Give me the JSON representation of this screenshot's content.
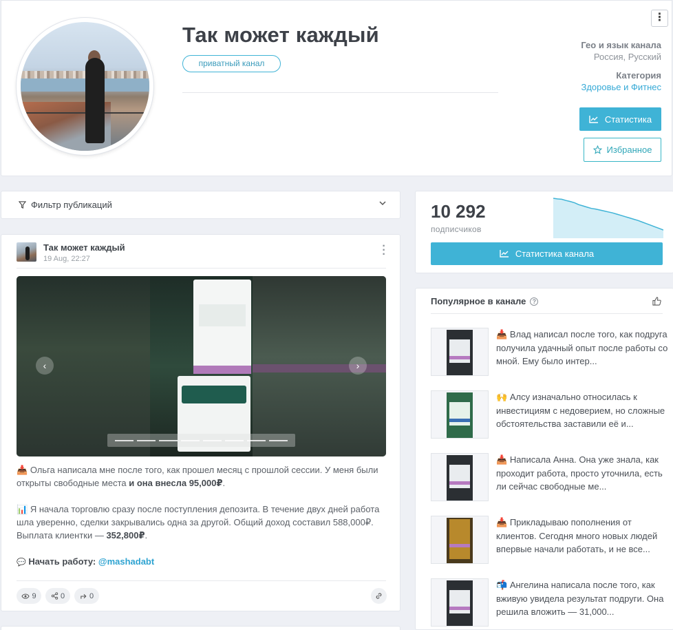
{
  "header": {
    "title": "Так может каждый",
    "badge": "приватный канал",
    "more_icon": "⋮",
    "geo_label": "Гео и язык канала",
    "geo_value": "Россия, Русский",
    "category_label": "Категория",
    "category_value": "Здоровье и Фитнес",
    "stats_button": "Статистика",
    "favorite_button": "Избранное"
  },
  "filter": {
    "label": "Фильтр публикаций"
  },
  "post": {
    "author": "Так может каждый",
    "date": "19 Aug, 22:27",
    "p1_text": "Ольга написала мне после того, как прошел месяц с прошлой сессии. У меня были открыты свободные места ",
    "p1_bold": "и она внесла 95,000₽",
    "p1_end": ".",
    "p2_text": "Я начала торговлю сразу после поступления депозита. В течение двух дней работа шла уверенно, сделки закрывались одна за другой. Общий доход составил 588,000₽. Выплата клиентки — ",
    "p2_bold": "352,800₽",
    "p2_end": ".",
    "p3_bold": "Начать работу: ",
    "p3_link": "@mashadabt",
    "views": "9",
    "shares": "0",
    "forwards": "0",
    "media_nav_prev": "‹",
    "media_nav_next": "›"
  },
  "stats": {
    "subscribers": "10 292",
    "subscribers_label": "подписчиков",
    "button": "Статистика канала",
    "sparkline": [
      1.0,
      0.98,
      0.97,
      0.93,
      0.9,
      0.86,
      0.8,
      0.76,
      0.72,
      0.68,
      0.66,
      0.63,
      0.6,
      0.57,
      0.54,
      0.5,
      0.46,
      0.42,
      0.38,
      0.34,
      0.3,
      0.25,
      0.2,
      0.15,
      0.1,
      0.05,
      0.0
    ]
  },
  "popular": {
    "title": "Популярное в канале",
    "items": [
      {
        "emoji": "📥",
        "text": "Влад написал после того, как подруга получила удачный опыт после работы со мной. Ему было интер..."
      },
      {
        "emoji": "🙌",
        "text": "Алсу изначально относилась к инвестициям с недоверием, но сложные обстоятельства заставили её и..."
      },
      {
        "emoji": "📥",
        "text": "Написала Анна. Она уже знала, как проходит работа, просто уточнила, есть ли сейчас свободные ме..."
      },
      {
        "emoji": "📥",
        "text": "Прикладываю пополнения от клиентов. Сегодня много новых людей впервые начали работать, и не все..."
      },
      {
        "emoji": "📬",
        "text": "Ангелина написала после того, как вживую увидела результат подруги. Она решила вложить — 31,000..."
      }
    ]
  },
  "colors": {
    "accent": "#3fb3d6",
    "favorite": "#37b6c6",
    "link": "#2ea3d1"
  }
}
